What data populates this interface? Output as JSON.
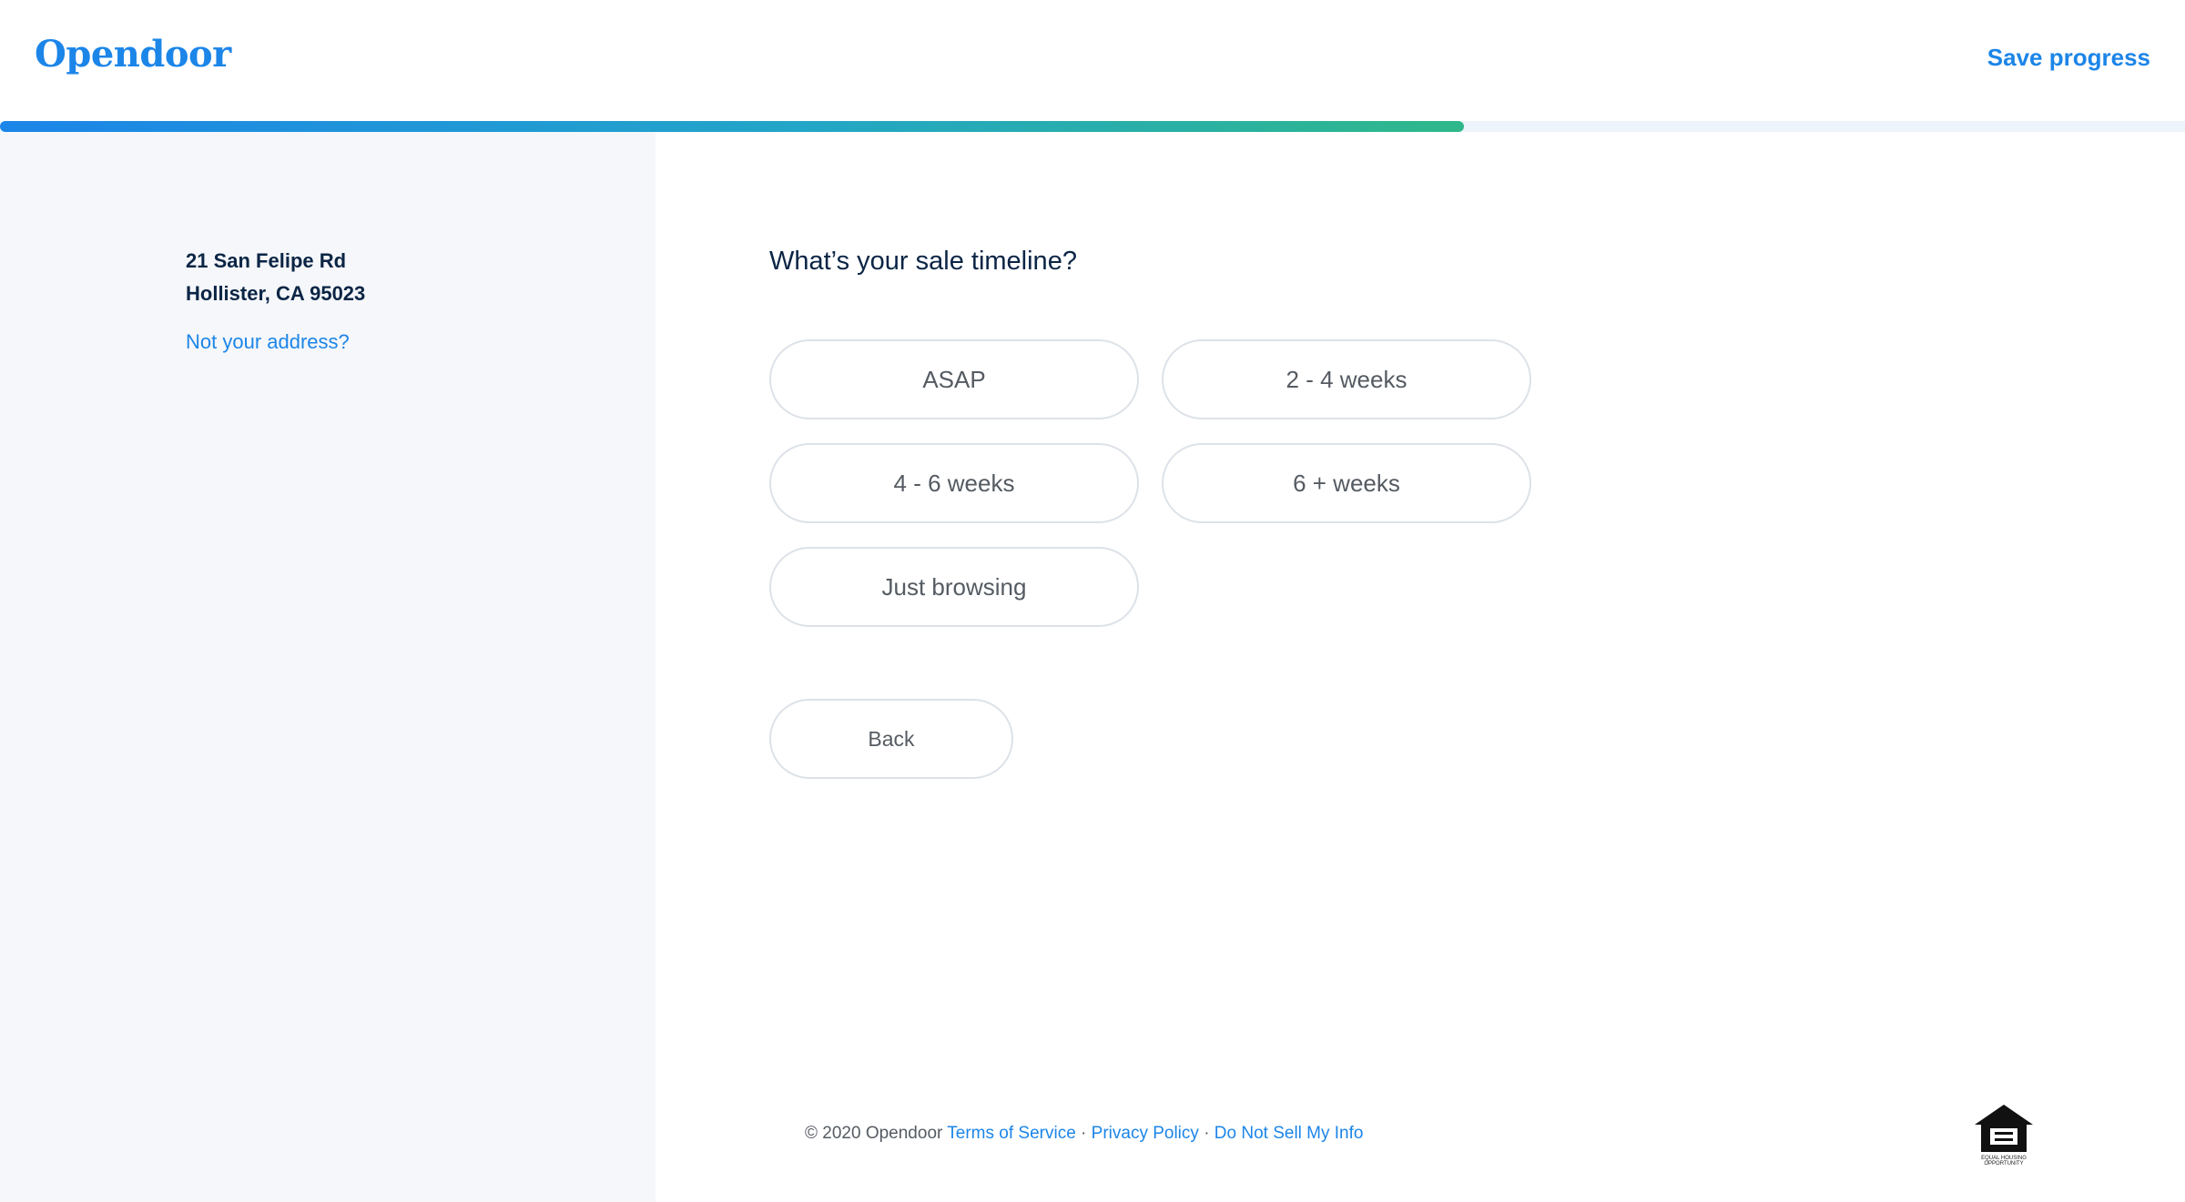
{
  "header": {
    "logo": "Opendoor",
    "save_label": "Save progress"
  },
  "progress": {
    "fraction": 0.67,
    "colors": {
      "start": "#1c85e8",
      "end": "#2fb88a",
      "track": "#eef4fb"
    }
  },
  "sidebar": {
    "address_line1": "21 San Felipe Rd",
    "address_line2": "Hollister, CA 95023",
    "not_address_link": "Not your address?"
  },
  "main": {
    "question": "What’s your sale timeline?",
    "options": [
      {
        "label": "ASAP"
      },
      {
        "label": "2 - 4 weeks"
      },
      {
        "label": "4 - 6 weeks"
      },
      {
        "label": "6 + weeks"
      },
      {
        "label": "Just browsing"
      }
    ],
    "back_label": "Back"
  },
  "footer": {
    "copyright": "© 2020  Opendoor",
    "terms": "Terms of Service",
    "privacy": "Privacy Policy",
    "do_not_sell": "Do Not Sell My Info",
    "separator": "·",
    "eho_text_1": "EQUAL HOUSING",
    "eho_text_2": "OPPORTUNITY"
  },
  "icons": {
    "equal_housing": "equal-housing-opportunity-icon"
  },
  "colors": {
    "brand": "#1c85e8",
    "text_dark": "#0b2545",
    "sidebar_bg": "#f5f7fa",
    "pill_border": "#dde2e8"
  }
}
